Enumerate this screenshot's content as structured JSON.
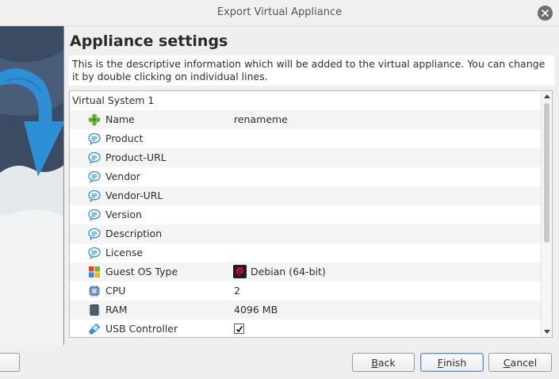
{
  "window": {
    "title": "Export Virtual Appliance"
  },
  "page": {
    "heading": "Appliance settings",
    "description": "This is the descriptive information which will be added to the virtual appliance. You can change it by double clicking on individual lines."
  },
  "tree": {
    "group": "Virtual System 1",
    "rows": [
      {
        "label": "Name",
        "value": "renameme",
        "icon": "name-icon"
      },
      {
        "label": "Product",
        "value": "",
        "icon": "description-icon"
      },
      {
        "label": "Product-URL",
        "value": "",
        "icon": "description-icon"
      },
      {
        "label": "Vendor",
        "value": "",
        "icon": "description-icon"
      },
      {
        "label": "Vendor-URL",
        "value": "",
        "icon": "description-icon"
      },
      {
        "label": "Version",
        "value": "",
        "icon": "description-icon"
      },
      {
        "label": "Description",
        "value": "",
        "icon": "description-icon"
      },
      {
        "label": "License",
        "value": "",
        "icon": "description-icon"
      },
      {
        "label": "Guest OS Type",
        "value": "Debian (64-bit)",
        "icon": "os-type-icon",
        "value_icon": "debian-icon"
      },
      {
        "label": "CPU",
        "value": "2",
        "icon": "cpu-icon"
      },
      {
        "label": "RAM",
        "value": "4096 MB",
        "icon": "ram-icon"
      },
      {
        "label": "USB Controller",
        "value": "",
        "icon": "usb-icon",
        "checked": true
      }
    ]
  },
  "buttons": {
    "left": "",
    "back_mnemonic": "B",
    "back_rest": "ack",
    "finish_mnemonic": "F",
    "finish_rest": "inish",
    "cancel_mnemonic": "C",
    "cancel_rest": "ancel"
  },
  "colors": {
    "accent": "#2d8fd5",
    "primary_button_border": "#5a8fc8"
  }
}
